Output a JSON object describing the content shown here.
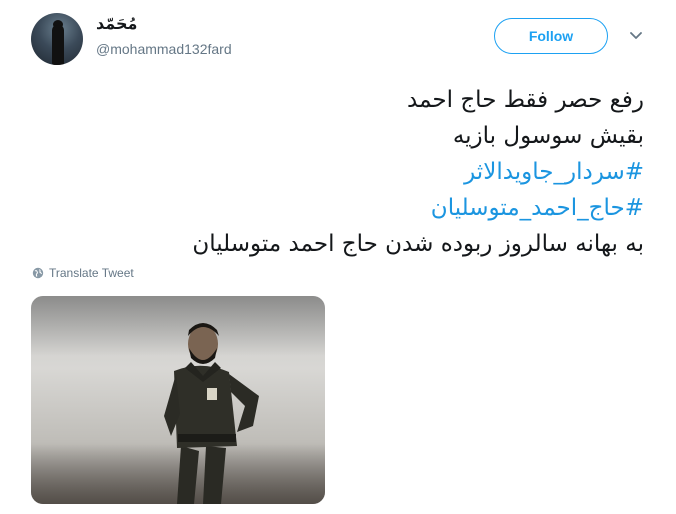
{
  "user": {
    "display_name": "مُحَمّد",
    "handle": "@mohammad132fard"
  },
  "actions": {
    "follow_label": "Follow"
  },
  "tweet": {
    "lines": [
      {
        "text": "رفع حصر فقط  حاج احمد",
        "type": "text"
      },
      {
        "text": "بقیش سوسول بازیه",
        "type": "text"
      },
      {
        "text": "#سردار_جاویدالاثر",
        "type": "hashtag"
      },
      {
        "text": "#حاج_احمد_متوسلیان",
        "type": "hashtag"
      },
      {
        "text": "به بهانه سالروز ربوده شدن حاج احمد متوسلیان",
        "type": "text"
      }
    ],
    "translate_label": "Translate Tweet"
  },
  "colors": {
    "accent": "#1da1f2",
    "hashtag": "#1b95e0",
    "text": "#14171a",
    "muted": "#657786"
  },
  "icons": {
    "caret": "chevron-down-icon",
    "translate": "globe-icon"
  }
}
